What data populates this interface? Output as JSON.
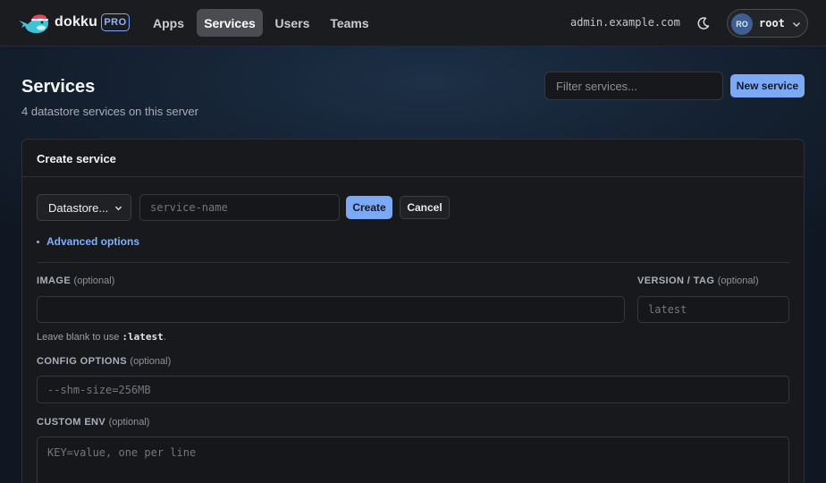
{
  "header": {
    "brand": "dokku",
    "badge": "PRO",
    "nav": [
      {
        "label": "Apps"
      },
      {
        "label": "Services",
        "active": true
      },
      {
        "label": "Users"
      },
      {
        "label": "Teams"
      }
    ],
    "host": "admin.example.com",
    "theme_icon": "moon-icon",
    "user": {
      "initials": "RO",
      "name": "root"
    }
  },
  "page": {
    "title": "Services",
    "subtitle": "4 datastore services on this server",
    "filter_placeholder": "Filter services...",
    "new_button": "New service"
  },
  "create_form": {
    "title": "Create service",
    "datastore_select": "Datastore...",
    "name_placeholder": "service-name",
    "create_button": "Create",
    "cancel_button": "Cancel",
    "advanced_toggle": "Advanced options",
    "image_label": "IMAGE",
    "image_optional": "(optional)",
    "image_value": "",
    "version_label": "VERSION / TAG",
    "version_optional": "(optional)",
    "version_placeholder": "latest",
    "image_hint_prefix": "Leave blank to use ",
    "image_hint_code": ":latest",
    "image_hint_suffix": ".",
    "config_label": "CONFIG OPTIONS",
    "config_optional": "(optional)",
    "config_placeholder": "--shm-size=256MB",
    "env_label": "CUSTOM ENV",
    "env_optional": "(optional)",
    "env_placeholder": "KEY=value, one per line"
  },
  "colors": {
    "accent": "#7ba9f5",
    "link": "#7fb0ff",
    "background": "#121a25",
    "topbar": "#1b1c1f",
    "card": "#18191c",
    "whale": "#3fc1d6",
    "whale_hat": "#e0475b"
  }
}
